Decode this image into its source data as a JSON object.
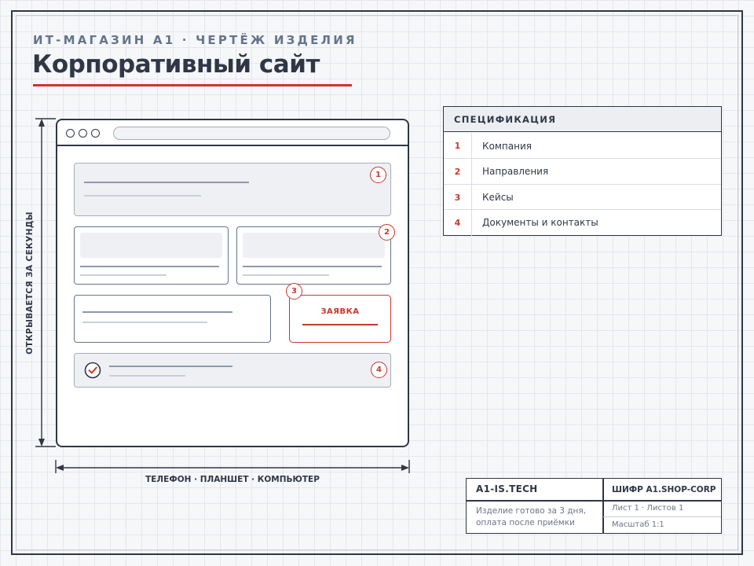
{
  "header": {
    "subtitle": "ИТ-МАГАЗИН A1 · ЧЕРТЁЖ ИЗДЕЛИЯ",
    "title": "Корпоративный сайт"
  },
  "dimensions": {
    "vertical_label": "ОТКРЫВАЕТСЯ ЗА СЕКУНДЫ",
    "horizontal_label": "ТЕЛЕФОН · ПЛАНШЕТ · КОМПЬЮТЕР"
  },
  "mockup": {
    "cta_label": "ЗАЯВКА",
    "badges": [
      "1",
      "2",
      "3",
      "4"
    ],
    "icons": {
      "checkmark": "check-circle-icon",
      "window_controls": "window-dot-icon"
    }
  },
  "spec": {
    "title": "СПЕЦИФИКАЦИЯ",
    "rows": [
      {
        "num": "1",
        "text": "Компания"
      },
      {
        "num": "2",
        "text": "Направления"
      },
      {
        "num": "3",
        "text": "Кейсы"
      },
      {
        "num": "4",
        "text": "Документы и контакты"
      }
    ]
  },
  "stamp": {
    "company": "A1-IS.TECH",
    "code": "ШИФР A1.SHOP-CORP",
    "note": "Изделие готово за 3 дня, оплата после приёмки",
    "sheet": "Лист 1 · Листов 1",
    "scale": "Масштаб 1:1"
  },
  "colors": {
    "ink": "#2f3747",
    "accent": "#c9372c",
    "muted": "#64748b",
    "paper": "#f6f7f9"
  }
}
